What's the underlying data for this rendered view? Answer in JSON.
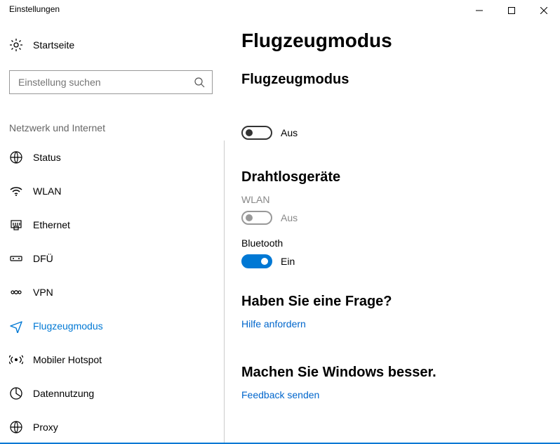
{
  "window": {
    "title": "Einstellungen"
  },
  "sidebar": {
    "home": "Startseite",
    "search_placeholder": "Einstellung suchen",
    "group": "Netzwerk und Internet",
    "items": [
      {
        "label": "Status"
      },
      {
        "label": "WLAN"
      },
      {
        "label": "Ethernet"
      },
      {
        "label": "DFÜ"
      },
      {
        "label": "VPN"
      },
      {
        "label": "Flugzeugmodus"
      },
      {
        "label": "Mobiler Hotspot"
      },
      {
        "label": "Datennutzung"
      },
      {
        "label": "Proxy"
      }
    ],
    "selected_index": 5
  },
  "main": {
    "title": "Flugzeugmodus",
    "airplane": {
      "heading": "Flugzeugmodus",
      "state_label": "Aus",
      "on": false
    },
    "wireless": {
      "heading": "Drahtlosgeräte",
      "wlan": {
        "name": "WLAN",
        "state_label": "Aus",
        "on": false,
        "disabled": true
      },
      "bluetooth": {
        "name": "Bluetooth",
        "state_label": "Ein",
        "on": true
      }
    },
    "help": {
      "heading": "Haben Sie eine Frage?",
      "link": "Hilfe anfordern"
    },
    "feedback": {
      "heading": "Machen Sie Windows besser.",
      "link": "Feedback senden"
    }
  }
}
